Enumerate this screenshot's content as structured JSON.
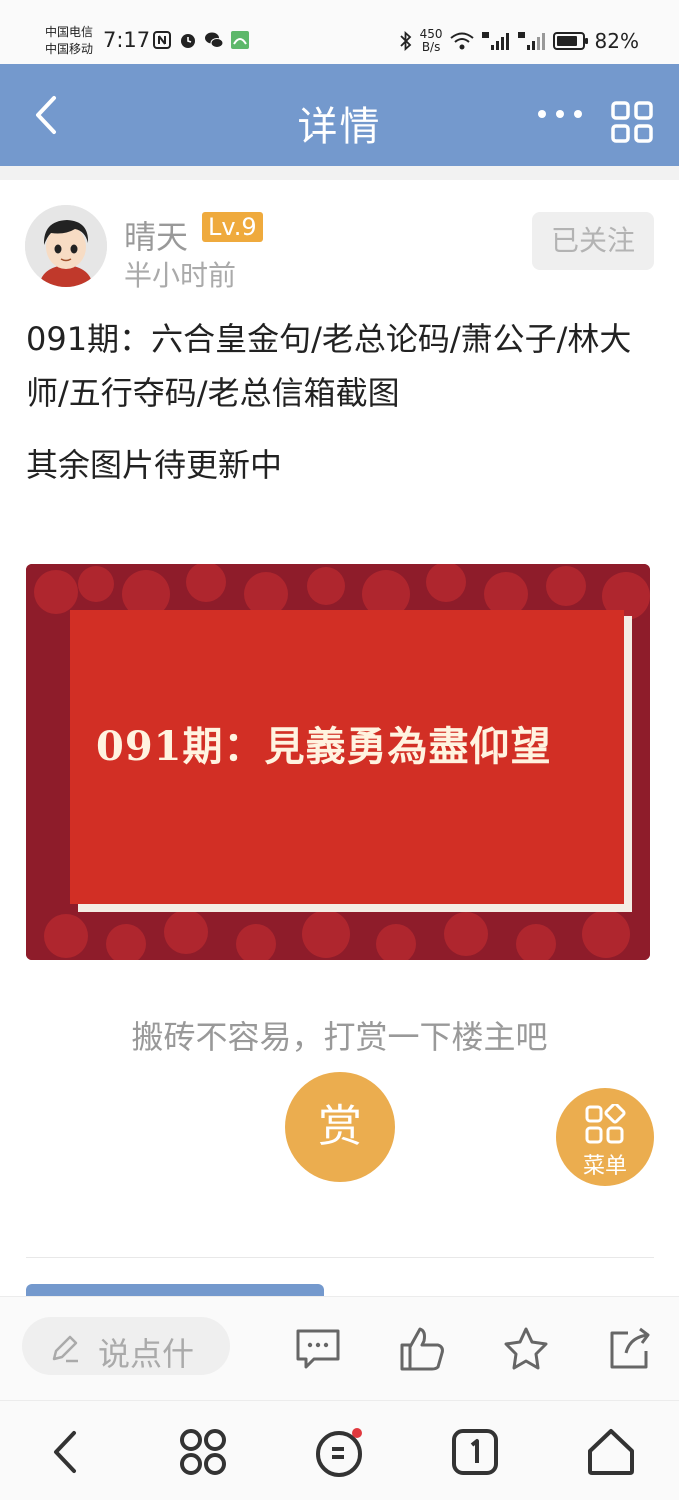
{
  "status_bar": {
    "carrier_1": "中国电信",
    "carrier_2": "中国移动",
    "time": "7:17",
    "net_speed_value": "450",
    "net_speed_unit": "B/s",
    "battery": "82%"
  },
  "header": {
    "title": "详情"
  },
  "post": {
    "author": "晴天",
    "level": "Lv.9",
    "time": "半小时前",
    "follow_label": "已关注",
    "title": "091期：六合皇金句/老总论码/萧公子/林大师/五行夺码/老总信箱截图",
    "subtitle": "其余图片待更新中",
    "image_caption": "091期：見義勇為盡仰望"
  },
  "reward": {
    "prompt": "搬砖不容易，打赏一下楼主吧",
    "button_label": "赏"
  },
  "menu_fab": {
    "label": "菜单"
  },
  "action_bar": {
    "comment_placeholder": "说点什"
  },
  "colors": {
    "header_bg": "#7499cd",
    "accent_gold": "#ebad4f",
    "image_red": "#d22f25",
    "image_border": "#8e1c2a"
  }
}
